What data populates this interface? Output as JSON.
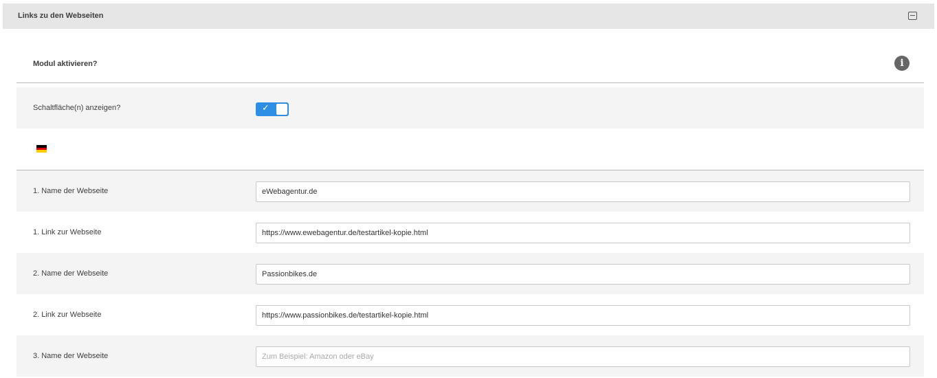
{
  "panel": {
    "title": "Links zu den Webseiten",
    "collapse_icon": "collapse-icon"
  },
  "modul": {
    "label": "Modul aktivieren?",
    "info_icon": "info-icon",
    "info_glyph": "i"
  },
  "show_buttons": {
    "label": "Schaltfläche(n) anzeigen?",
    "enabled": true,
    "check_glyph": "✓",
    "accent": "#2d8ee3"
  },
  "language": {
    "flag_icon": "flag-germany-icon",
    "flag_colors": [
      "#000000",
      "#dd0000",
      "#ffce00"
    ]
  },
  "fields": [
    {
      "label": "1. Name der Webseite",
      "value": "eWebagentur.de",
      "placeholder": ""
    },
    {
      "label": "1. Link zur Webseite",
      "value": "https://www.ewebagentur.de/testartikel-kopie.html",
      "placeholder": ""
    },
    {
      "label": "2. Name der Webseite",
      "value": "Passionbikes.de",
      "placeholder": ""
    },
    {
      "label": "2. Link zur Webseite",
      "value": "https://www.passionbikes.de/testartikel-kopie.html",
      "placeholder": ""
    },
    {
      "label": "3. Name der Webseite",
      "value": "",
      "placeholder": "Zum Beispiel: Amazon oder eBay"
    }
  ]
}
